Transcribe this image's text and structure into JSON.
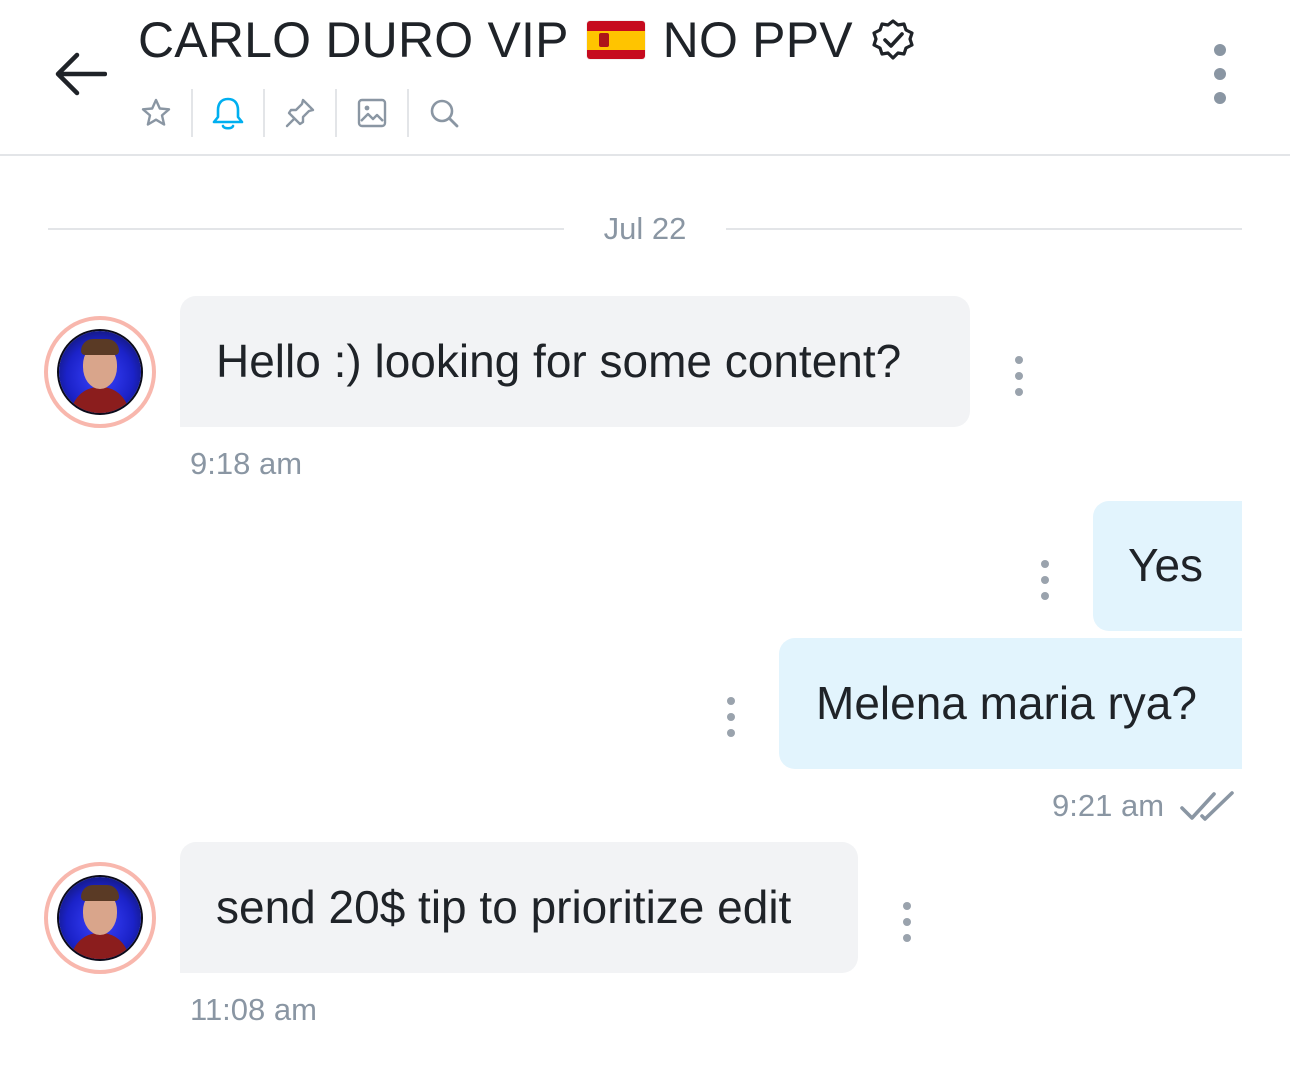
{
  "header": {
    "title_part1": "CARLO DURO VIP",
    "flag_icon": "spain-flag-icon",
    "title_part2": "NO PPV",
    "verified_icon": "verified-badge-icon",
    "toolbar": [
      {
        "icon": "star-icon",
        "active": false
      },
      {
        "icon": "bell-icon",
        "active": true
      },
      {
        "icon": "pin-icon",
        "active": false
      },
      {
        "icon": "image-icon",
        "active": false
      },
      {
        "icon": "search-icon",
        "active": false
      }
    ],
    "accent_color": "#00aff0"
  },
  "date_divider": "Jul 22",
  "messages": [
    {
      "direction": "in",
      "text": "Hello :) looking for some content?",
      "time": "9:18 am"
    },
    {
      "direction": "out",
      "text": "Yes"
    },
    {
      "direction": "out",
      "text": "Melena maria rya?",
      "time": "9:21 am",
      "status": "read"
    },
    {
      "direction": "in",
      "text": "send 20$ tip to prioritize edit",
      "time": "11:08 am"
    }
  ],
  "colors": {
    "incoming_bubble": "#f2f3f5",
    "outgoing_bubble": "#e2f4fd",
    "muted_text": "#8a96a3",
    "avatar_ring": "#f8b7ad"
  }
}
